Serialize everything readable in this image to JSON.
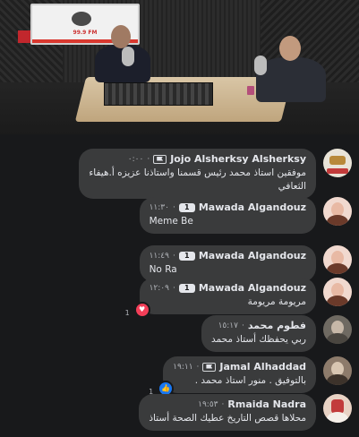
{
  "video": {
    "station_frequency": "99.9 FM"
  },
  "comments": [
    {
      "name": "Jojo Alsherksy Alsherksy",
      "time": "٠:٠٠",
      "badge": "flag",
      "text_line1": "موفقين استاذ محمد رئيس قسمنا واستاذنا عزيزه أ.هيفاء",
      "text_line2": "الثعافي",
      "avatar_color": "#e9e4d8",
      "avatar_accent": "#b8893a"
    },
    {
      "name": "Mawada Algandouz",
      "time": "١١:٣٠",
      "badge": "top",
      "badge_text": "1",
      "text_line1": "Meme Be",
      "avatar_color": "#f1d9cf",
      "avatar_accent": "#6b3a2a"
    },
    {
      "name": "Mawada Algandouz",
      "time": "١١:٤٩",
      "badge": "top",
      "badge_text": "1",
      "text_line1": "No Ra",
      "avatar_color": "#f1d9cf",
      "avatar_accent": "#6b3a2a"
    },
    {
      "name": "Mawada Algandouz",
      "time": "١٢:٠٩",
      "badge": "top",
      "badge_text": "1",
      "text_line1": "مريومة مريومة",
      "reaction": "love",
      "reaction_count": "1",
      "avatar_color": "#f1d9cf",
      "avatar_accent": "#6b3a2a"
    },
    {
      "name": "فطوم محمد",
      "time": "١٥:١٧",
      "badge": "none",
      "text_line1": "ربي يحفظك أستاذ محمد",
      "avatar_color": "#6f6a62",
      "avatar_accent": "#c7b8a8"
    },
    {
      "name": "Jamal Alhaddad",
      "time": "١٩:١١",
      "badge": "flag",
      "text_line1": "بالتوفيق . منور استاذ محمد .",
      "reaction": "like",
      "reaction_count": "1",
      "avatar_color": "#8d7b6b",
      "avatar_accent": "#d8c6b2"
    },
    {
      "name": "Rmaida Nadra",
      "time": "١٩:٥٣",
      "badge": "none",
      "text_line1": "محلاها قصص التاريخ  عطيك الصحة أستاذ",
      "avatar_color": "#e8d2c4",
      "avatar_accent": "#c23b3b"
    }
  ],
  "colors": {
    "background": "#18191b",
    "bubble": "#3a3b3c",
    "love": "#f33e58",
    "like": "#1877f2"
  }
}
